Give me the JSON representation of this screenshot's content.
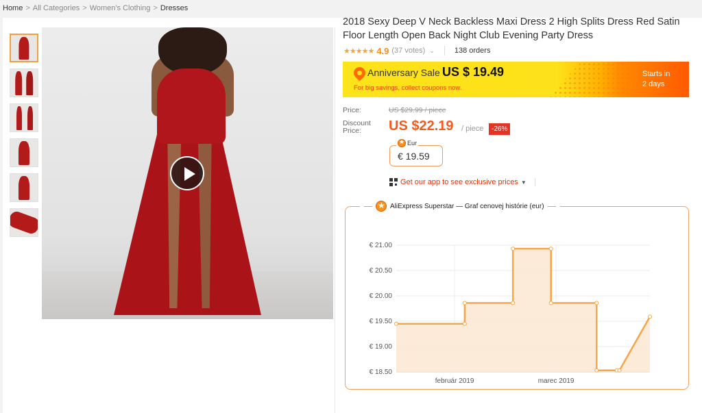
{
  "breadcrumb": {
    "home": "Home",
    "sep": ">",
    "items": [
      "All Categories",
      "Women's Clothing",
      "Dresses"
    ]
  },
  "product": {
    "title": "2018 Sexy Deep V Neck Backless Maxi Dress 2 High Splits Dress Red Satin Floor Length Open Back Night Club Evening Party Dress",
    "stars": "★★★★★",
    "rating": "4.9",
    "votes": "(37 votes)",
    "orders": "138 orders",
    "gallery_thumbnails": 6,
    "active_thumbnail": 1
  },
  "banner": {
    "sale_label": "Anniversary Sale",
    "sale_price": "US $ 19.49",
    "subtext": "For big savings, collect coupons now.",
    "starts_label": "Starts in",
    "starts_value": "2 days"
  },
  "pricing": {
    "price_label": "Price:",
    "original_price": "US $29.99 / piece",
    "discount_label": "Discount Price:",
    "discount_price": "US $22.19",
    "unit": "/ piece",
    "discount_badge": "-26%",
    "eur_tag": "Eur",
    "eur_value": "€ 19.59"
  },
  "app_promo": {
    "label": "Get our app to see exclusive prices"
  },
  "colors": {
    "accent": "#f25b1c",
    "chart_line": "#f5a54a",
    "chart_fill": "#fde9d6",
    "banner_yellow": "#fde319"
  },
  "chart_data": {
    "type": "area",
    "title": "AliExpress Superstar — Graf cenovej histórie (eur)",
    "ylim": [
      18.5,
      21.0
    ],
    "yticks": [
      "€ 21.00",
      "€ 20.50",
      "€ 20.00",
      "€ 19.50",
      "€ 19.00",
      "€ 18.50"
    ],
    "ytick_values": [
      21.0,
      20.5,
      20.0,
      19.5,
      19.0,
      18.5
    ],
    "xticks": [
      "február 2019",
      "marec 2019"
    ],
    "series": [
      {
        "values": [
          19.45,
          19.45,
          19.86,
          19.86,
          20.93,
          20.93,
          19.86,
          19.86,
          18.53,
          18.53,
          18.53,
          19.59
        ],
        "points_x": [
          0,
          0.27,
          0.27,
          0.46,
          0.46,
          0.61,
          0.61,
          0.79,
          0.79,
          0.87,
          0.88,
          1.0
        ]
      }
    ],
    "grid": true
  }
}
